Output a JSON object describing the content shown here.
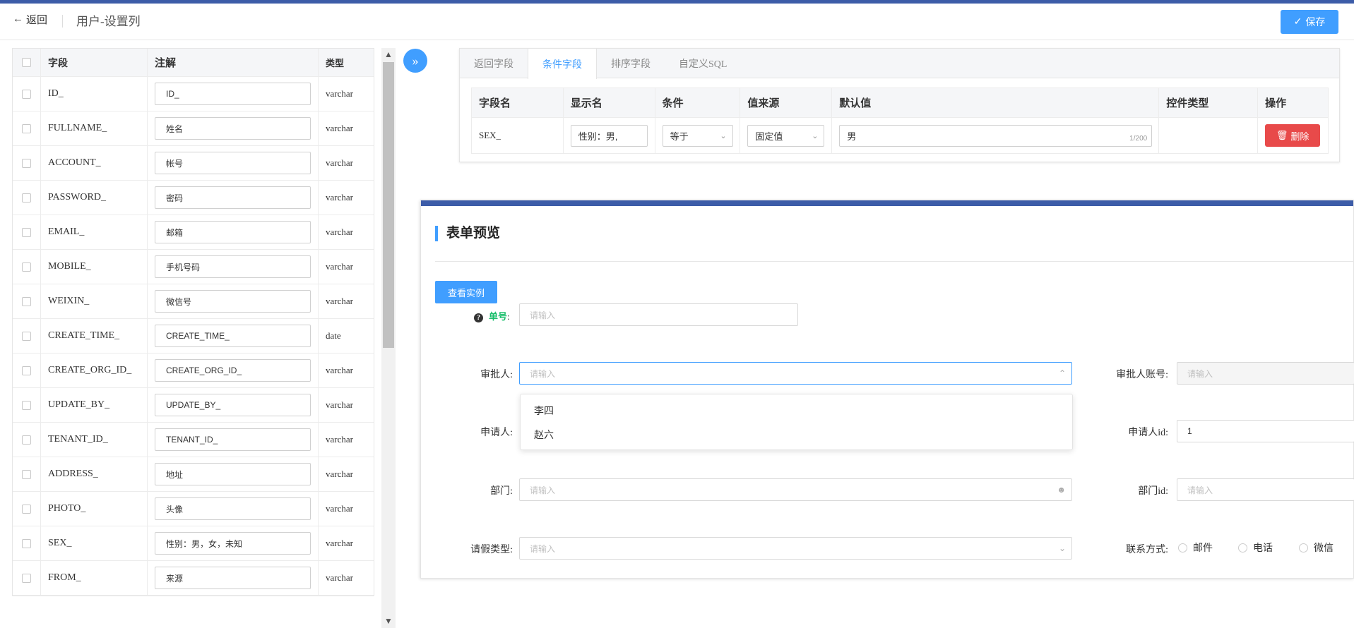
{
  "header": {
    "back_label": "返回",
    "title": "用户-设置列",
    "save_label": "保存"
  },
  "left_table": {
    "headers": {
      "field": "字段",
      "note": "注解",
      "type": "类型"
    },
    "rows": [
      {
        "field": "ID_",
        "note": "ID_",
        "type": "varchar"
      },
      {
        "field": "FULLNAME_",
        "note": "姓名",
        "type": "varchar"
      },
      {
        "field": "ACCOUNT_",
        "note": "帐号",
        "type": "varchar"
      },
      {
        "field": "PASSWORD_",
        "note": "密码",
        "type": "varchar"
      },
      {
        "field": "EMAIL_",
        "note": "邮箱",
        "type": "varchar"
      },
      {
        "field": "MOBILE_",
        "note": "手机号码",
        "type": "varchar"
      },
      {
        "field": "WEIXIN_",
        "note": "微信号",
        "type": "varchar"
      },
      {
        "field": "CREATE_TIME_",
        "note": "CREATE_TIME_",
        "type": "date"
      },
      {
        "field": "CREATE_ORG_ID_",
        "note": "CREATE_ORG_ID_",
        "type": "varchar"
      },
      {
        "field": "UPDATE_BY_",
        "note": "UPDATE_BY_",
        "type": "varchar"
      },
      {
        "field": "TENANT_ID_",
        "note": "TENANT_ID_",
        "type": "varchar"
      },
      {
        "field": "ADDRESS_",
        "note": "地址",
        "type": "varchar"
      },
      {
        "field": "PHOTO_",
        "note": "头像",
        "type": "varchar"
      },
      {
        "field": "SEX_",
        "note": "性别：男，女，未知",
        "type": "varchar"
      },
      {
        "field": "FROM_",
        "note": "来源",
        "type": "varchar"
      }
    ]
  },
  "tabs": [
    "返回字段",
    "条件字段",
    "排序字段",
    "自定义SQL"
  ],
  "active_tab": "条件字段",
  "condition_table": {
    "headers": [
      "字段名",
      "显示名",
      "条件",
      "值来源",
      "默认值",
      "控件类型",
      "操作"
    ],
    "row": {
      "field": "SEX_",
      "display": "性别：男,",
      "condition": "等于",
      "source": "固定值",
      "default": "男",
      "counter": "1/200",
      "delete_label": "删除"
    }
  },
  "preview": {
    "title": "表单预览",
    "view_btn": "查看实例",
    "danhao_label": "单号",
    "placeholder": "请输入",
    "approver_label": "审批人:",
    "approver_account_label": "审批人账号:",
    "applicant_label": "申请人:",
    "applicant_id_label": "申请人id:",
    "applicant_id_value": "1",
    "dept_label": "部门:",
    "dept_id_label": "部门id:",
    "leave_type_label": "请假类型:",
    "contact_label": "联系方式:",
    "contact_options": [
      "邮件",
      "电话",
      "微信"
    ],
    "dropdown_options": [
      "李四",
      "赵六"
    ]
  },
  "colors": {
    "primary": "#409eff",
    "danger": "#e84a4a",
    "nav": "#3c5ca8",
    "required": "#19be6b"
  }
}
